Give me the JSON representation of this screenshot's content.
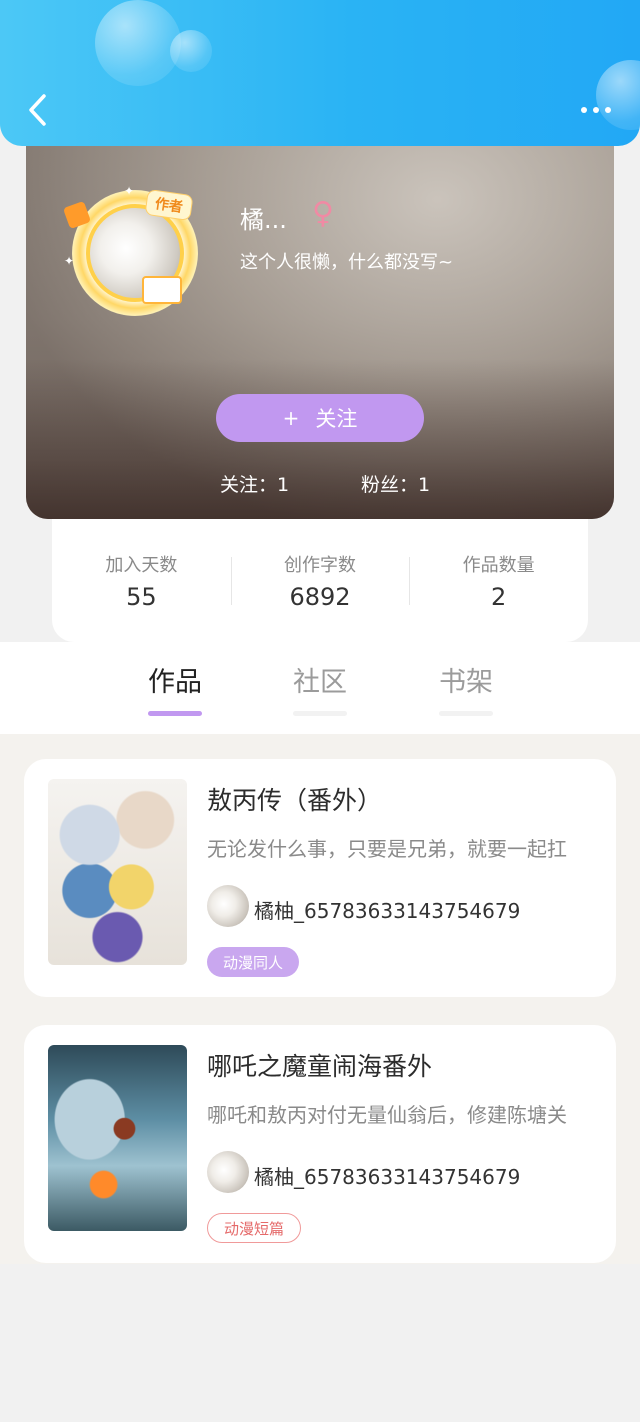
{
  "header": {
    "back_icon": "chevron-left-icon",
    "more_icon": "more-horizontal-icon"
  },
  "profile": {
    "author_badge": "作者",
    "username": "橘...",
    "gender_symbol": "♀",
    "bio": "这个人很懒，什么都没写~",
    "follow_button": {
      "plus": "+",
      "label": "关注"
    },
    "following": "关注：1",
    "followers": "粉丝：1"
  },
  "stats": [
    {
      "label": "加入天数",
      "value": "55"
    },
    {
      "label": "创作字数",
      "value": "6892"
    },
    {
      "label": "作品数量",
      "value": "2"
    }
  ],
  "tabs": [
    {
      "label": "作品",
      "active": true
    },
    {
      "label": "社区",
      "active": false
    },
    {
      "label": "书架",
      "active": false
    }
  ],
  "works": [
    {
      "title": "敖丙传（番外）",
      "description": "无论发什么事，只要是兄弟，就要一起扛",
      "author": "橘柚_65783633143754679",
      "tag": "动漫同人"
    },
    {
      "title": "哪吒之魔童闹海番外",
      "description": "哪吒和敖丙对付无量仙翁后，修建陈塘关",
      "author": "橘柚_65783633143754679",
      "tag": "动漫短篇"
    }
  ],
  "colors": {
    "header_gradient_start": "#4cc8f6",
    "header_gradient_end": "#22a8f5",
    "accent_purple": "#c198f0",
    "gender_pink": "#f08aa4",
    "tag_outline_red": "#e56a6a"
  }
}
